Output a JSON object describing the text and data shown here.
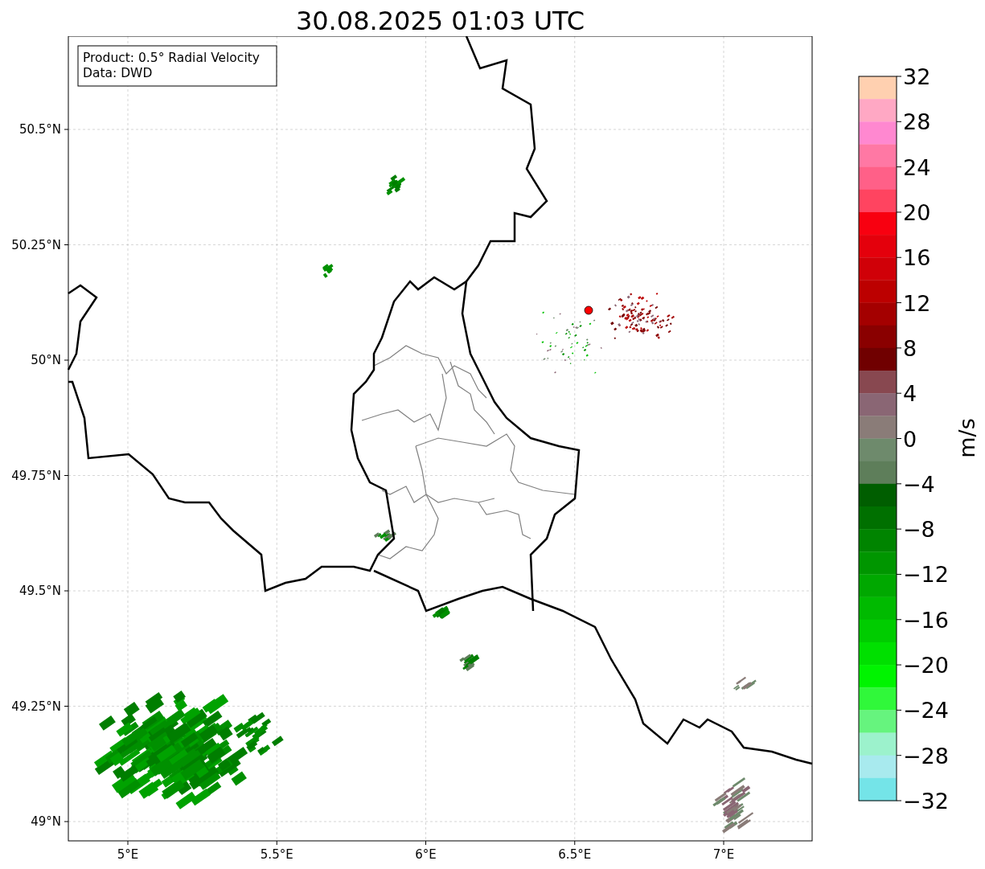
{
  "title": "30.08.2025 01:03 UTC",
  "info_box": {
    "lines": [
      "Product: 0.5° Radial Velocity",
      "Data: DWD"
    ]
  },
  "map": {
    "lat_ticks": [
      "50.5°N",
      "50.25°N",
      "50°N",
      "49.75°N",
      "49.5°N",
      "49.25°N",
      "49°N"
    ],
    "lon_ticks": [
      "5°E",
      "5.5°E",
      "6°E",
      "6.5°E",
      "7°E"
    ]
  },
  "colorbar": {
    "label": "m/s",
    "ticks": [
      "32",
      "28",
      "24",
      "20",
      "16",
      "12",
      "8",
      "4",
      "0",
      "−4",
      "−8",
      "−12",
      "−16",
      "−20",
      "−24",
      "−28",
      "−32"
    ],
    "bands": [
      {
        "color": "#ffd0b0"
      },
      {
        "color": "#ffa8c4"
      },
      {
        "color": "#ff88d0"
      },
      {
        "color": "#ff78a4"
      },
      {
        "color": "#ff6088"
      },
      {
        "color": "#ff4460"
      },
      {
        "color": "#f80010"
      },
      {
        "color": "#e4000c"
      },
      {
        "color": "#d00008"
      },
      {
        "color": "#bc0000"
      },
      {
        "color": "#a40000"
      },
      {
        "color": "#8a0000"
      },
      {
        "color": "#700000"
      },
      {
        "color": "#884850"
      },
      {
        "color": "#8a6674"
      },
      {
        "color": "#8a7c78"
      },
      {
        "color": "#6e8a6c"
      },
      {
        "color": "#5e7e5a"
      },
      {
        "color": "#005e00"
      },
      {
        "color": "#007000"
      },
      {
        "color": "#008400"
      },
      {
        "color": "#009600"
      },
      {
        "color": "#00a800"
      },
      {
        "color": "#00ba00"
      },
      {
        "color": "#00cc00"
      },
      {
        "color": "#00e000"
      },
      {
        "color": "#00f400"
      },
      {
        "color": "#30f83a"
      },
      {
        "color": "#66f47e"
      },
      {
        "color": "#9cf2cc"
      },
      {
        "color": "#a8eaee"
      },
      {
        "color": "#74e4e8"
      }
    ]
  }
}
